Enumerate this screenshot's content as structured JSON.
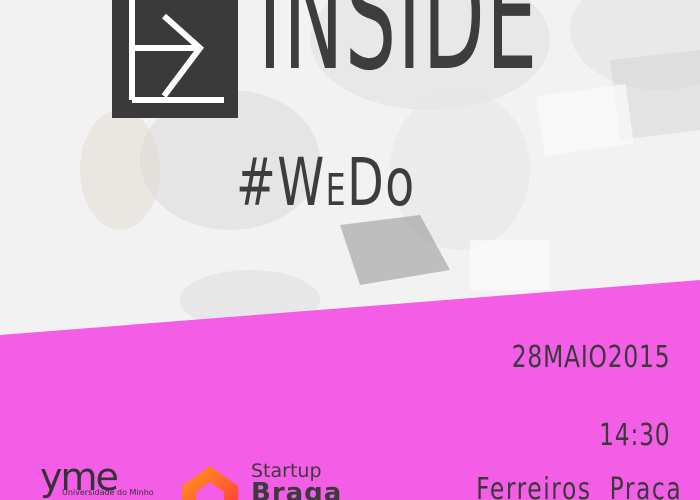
{
  "poster": {
    "title": "INSIDE",
    "hashtag_prefix": "#W",
    "hashtag_small": "E",
    "hashtag_suffix": "D",
    "hashtag_end": "o",
    "date": "28MAIO2015",
    "time": "14:30",
    "venue_left": "Ferreiros",
    "venue_right": "Praça"
  },
  "logos": {
    "uminho_mark": "yme",
    "uminho_subtitle": "Universidade do Minho",
    "startup_word": "Startup",
    "startup_braga": "Braga"
  },
  "colors": {
    "pink": "#f45de6",
    "dark": "#3a3a3a"
  }
}
